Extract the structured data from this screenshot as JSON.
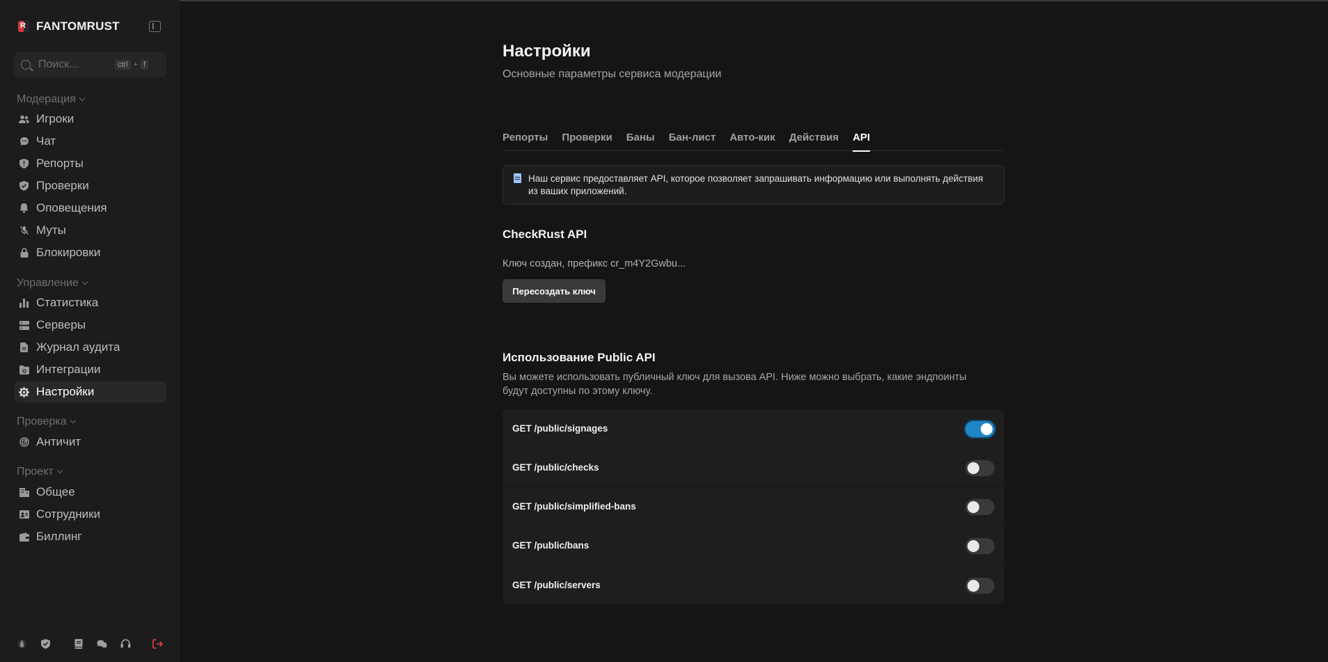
{
  "brand": {
    "name": "FANTOMRUST",
    "logo_letter": "R"
  },
  "search": {
    "placeholder": "Поиск...",
    "kbd_ctrl": "ctrl",
    "kbd_plus": "+",
    "kbd_key": "f"
  },
  "sidebar": {
    "groups": [
      {
        "title": "Модерация",
        "items": [
          {
            "label": "Игроки",
            "icon": "users-icon"
          },
          {
            "label": "Чат",
            "icon": "chat-icon"
          },
          {
            "label": "Репорты",
            "icon": "shield-alert-icon"
          },
          {
            "label": "Проверки",
            "icon": "shield-check-icon"
          },
          {
            "label": "Оповещения",
            "icon": "bell-icon"
          },
          {
            "label": "Муты",
            "icon": "mic-off-icon"
          },
          {
            "label": "Блокировки",
            "icon": "lock-icon"
          }
        ]
      },
      {
        "title": "Управление",
        "items": [
          {
            "label": "Статистика",
            "icon": "bar-chart-icon"
          },
          {
            "label": "Серверы",
            "icon": "server-icon"
          },
          {
            "label": "Журнал аудита",
            "icon": "file-icon"
          },
          {
            "label": "Интеграции",
            "icon": "folder-link-icon"
          },
          {
            "label": "Настройки",
            "icon": "gear-icon",
            "active": true
          }
        ]
      },
      {
        "title": "Проверка",
        "items": [
          {
            "label": "Античит",
            "icon": "radar-icon"
          }
        ]
      },
      {
        "title": "Проект",
        "items": [
          {
            "label": "Общее",
            "icon": "building-icon"
          },
          {
            "label": "Сотрудники",
            "icon": "id-card-icon"
          },
          {
            "label": "Биллинг",
            "icon": "wallet-icon"
          }
        ]
      }
    ],
    "bottom_icons": [
      "bottle-icon",
      "shield-icon",
      "book-icon",
      "chat-bubbles-icon",
      "headset-icon",
      "logout-icon"
    ]
  },
  "page": {
    "title": "Настройки",
    "subtitle": "Основные параметры сервиса модерации"
  },
  "tabs": [
    {
      "label": "Репорты"
    },
    {
      "label": "Проверки"
    },
    {
      "label": "Баны"
    },
    {
      "label": "Бан-лист"
    },
    {
      "label": "Авто-кик"
    },
    {
      "label": "Действия"
    },
    {
      "label": "API",
      "active": true
    }
  ],
  "info": {
    "line1": "Наш сервис предоставляет API, которое позволяет запрашивать информацию или выполнять действия",
    "line2": "из ваших приложений."
  },
  "checkrust": {
    "title": "CheckRust API",
    "key_text": "Ключ создан, префикс cr_m4Y2Gwbu...",
    "regen_label": "Пересоздать ключ"
  },
  "public_api": {
    "title": "Использование Public API",
    "desc_line1": "Вы можете использовать публичный ключ для вызова API. Ниже можно выбрать, какие эндпоинты",
    "desc_line2": "будут доступны по этому ключу.",
    "endpoints": [
      {
        "label": "GET /public/signages",
        "enabled": true
      },
      {
        "label": "GET /public/checks",
        "enabled": false
      },
      {
        "label": "GET /public/simplified-bans",
        "enabled": false
      },
      {
        "label": "GET /public/bans",
        "enabled": false
      },
      {
        "label": "GET /public/servers",
        "enabled": false
      }
    ]
  },
  "colors": {
    "accent": "#1e86c6",
    "logout": "#e04040",
    "background": "#151515",
    "sidebar": "#1c1c1c"
  }
}
